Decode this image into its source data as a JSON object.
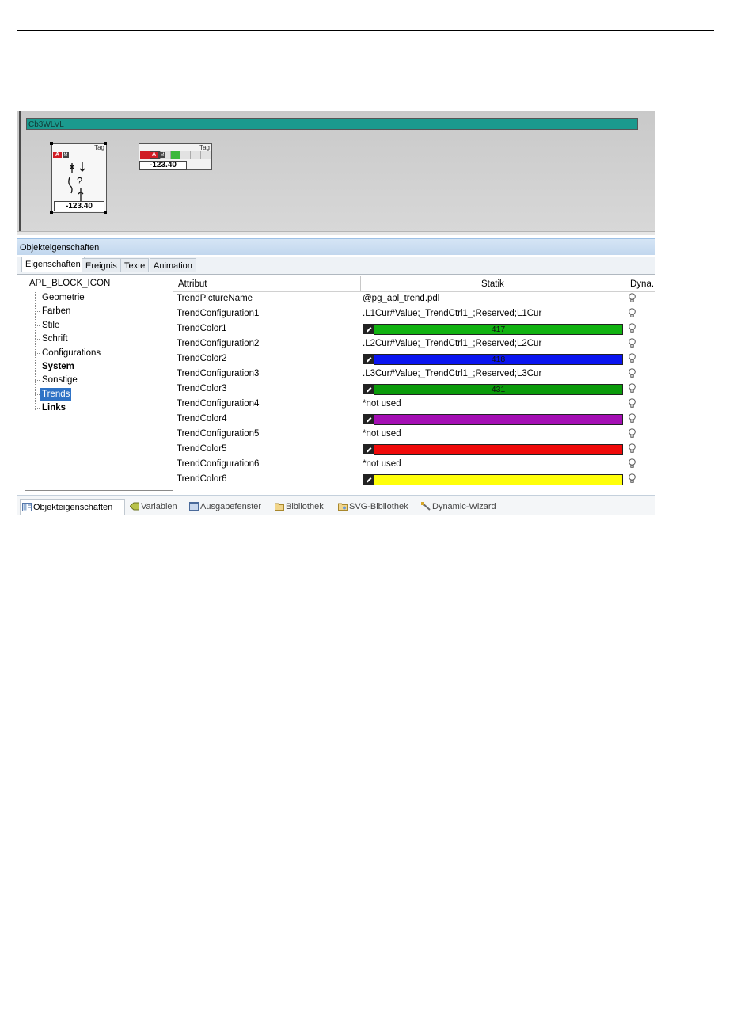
{
  "canvas": {
    "bar_label": "Cb3WLVL",
    "block_big": {
      "tag": "Tag",
      "badge_a": "A",
      "badge_m": "M",
      "value": "-123.40",
      "question": "?"
    },
    "block_small": {
      "tag": "Tag",
      "badge_a": "A",
      "badge_m": "M",
      "value": "-123.40"
    }
  },
  "panel": {
    "title": "Objekteigenschaften",
    "tabs": [
      "Eigenschaften",
      "Ereignis",
      "Texte",
      "Animation"
    ],
    "active_tab": "Eigenschaften"
  },
  "tree": {
    "root": "APL_BLOCK_ICON",
    "items": [
      {
        "label": "Geometrie",
        "bold": false,
        "selected": false
      },
      {
        "label": "Farben",
        "bold": false,
        "selected": false
      },
      {
        "label": "Stile",
        "bold": false,
        "selected": false
      },
      {
        "label": "Schrift",
        "bold": false,
        "selected": false
      },
      {
        "label": "Configurations",
        "bold": false,
        "selected": false
      },
      {
        "label": "System",
        "bold": true,
        "selected": false
      },
      {
        "label": "Sonstige",
        "bold": false,
        "selected": false
      },
      {
        "label": "Trends",
        "bold": false,
        "selected": true
      },
      {
        "label": "Links",
        "bold": true,
        "selected": false
      }
    ]
  },
  "grid": {
    "headers": {
      "attribute": "Attribut",
      "static": "Statik",
      "dynamic": "Dyna.."
    },
    "rows": [
      {
        "attribute": "TrendPictureName",
        "type": "text",
        "value": "@pg_apl_trend.pdl"
      },
      {
        "attribute": "TrendConfiguration1",
        "type": "text",
        "value": ".L1Cur#Value;_TrendCtrl1_;Reserved;L1Cur"
      },
      {
        "attribute": "TrendColor1",
        "type": "color",
        "value": "417",
        "color": "#11b211"
      },
      {
        "attribute": "TrendConfiguration2",
        "type": "text",
        "value": ".L2Cur#Value;_TrendCtrl1_;Reserved;L2Cur"
      },
      {
        "attribute": "TrendColor2",
        "type": "color",
        "value": "418",
        "color": "#0a14f0"
      },
      {
        "attribute": "TrendConfiguration3",
        "type": "text",
        "value": ".L3Cur#Value;_TrendCtrl1_;Reserved;L3Cur"
      },
      {
        "attribute": "TrendColor3",
        "type": "color",
        "value": "431",
        "color": "#0a9a0a"
      },
      {
        "attribute": "TrendConfiguration4",
        "type": "text",
        "value": "*not used"
      },
      {
        "attribute": "TrendColor4",
        "type": "color",
        "value": "",
        "color": "#a40fb4"
      },
      {
        "attribute": "TrendConfiguration5",
        "type": "text",
        "value": "*not used"
      },
      {
        "attribute": "TrendColor5",
        "type": "color",
        "value": "",
        "color": "#f00a0a"
      },
      {
        "attribute": "TrendConfiguration6",
        "type": "text",
        "value": "*not used"
      },
      {
        "attribute": "TrendColor6",
        "type": "color",
        "value": "",
        "color": "#ffff0a"
      }
    ]
  },
  "bottom_tabs": [
    {
      "label": "Objekteigenschaften",
      "icon": "properties-icon",
      "active": true
    },
    {
      "label": "Variablen",
      "icon": "variables-icon",
      "active": false
    },
    {
      "label": "Ausgabefenster",
      "icon": "output-window-icon",
      "active": false
    },
    {
      "label": "Bibliothek",
      "icon": "library-icon",
      "active": false
    },
    {
      "label": "SVG-Bibliothek",
      "icon": "svg-library-icon",
      "active": false
    },
    {
      "label": "Dynamic-Wizard",
      "icon": "wizard-icon",
      "active": false
    }
  ]
}
